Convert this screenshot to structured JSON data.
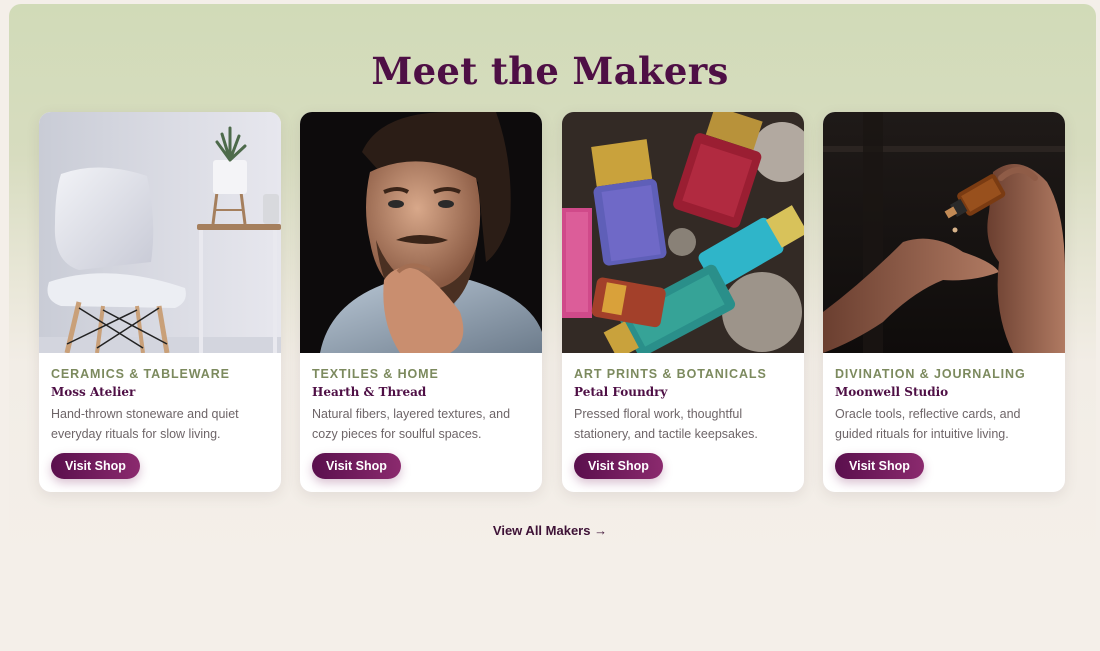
{
  "section": {
    "title": "Meet the Makers",
    "view_all_label": "View All Makers →"
  },
  "makers": [
    {
      "category": "CERAMICS & TABLEWARE",
      "name": "Moss Atelier",
      "description": "Hand-thrown stoneware and quiet everyday rituals for slow living.",
      "button_label": "Visit Shop",
      "image": "white-chair-and-plant"
    },
    {
      "category": "TEXTILES & HOME",
      "name": "Hearth & Thread",
      "description": "Natural fibers, layered textures, and cozy pieces for soulful spaces.",
      "button_label": "Visit Shop",
      "image": "bearded-man-portrait"
    },
    {
      "category": "ART PRINTS & BOTANICALS",
      "name": "Petal Foundry",
      "description": "Pressed floral work, thoughtful stationery, and tactile keepsakes.",
      "button_label": "Visit Shop",
      "image": "colorful-paint-brushes"
    },
    {
      "category": "DIVINATION & JOURNALING",
      "name": "Moonwell Studio",
      "description": "Oracle tools, reflective cards, and guided rituals for intuitive living.",
      "button_label": "Visit Shop",
      "image": "dropper-bottle-hands"
    }
  ],
  "colors": {
    "accent": "#4e0f45",
    "category": "#7c8a5e",
    "button_start": "#5a0f4d",
    "button_end": "#8b2a6e",
    "panel_top": "#d1dbb8",
    "page_bg": "#f4efe9"
  }
}
